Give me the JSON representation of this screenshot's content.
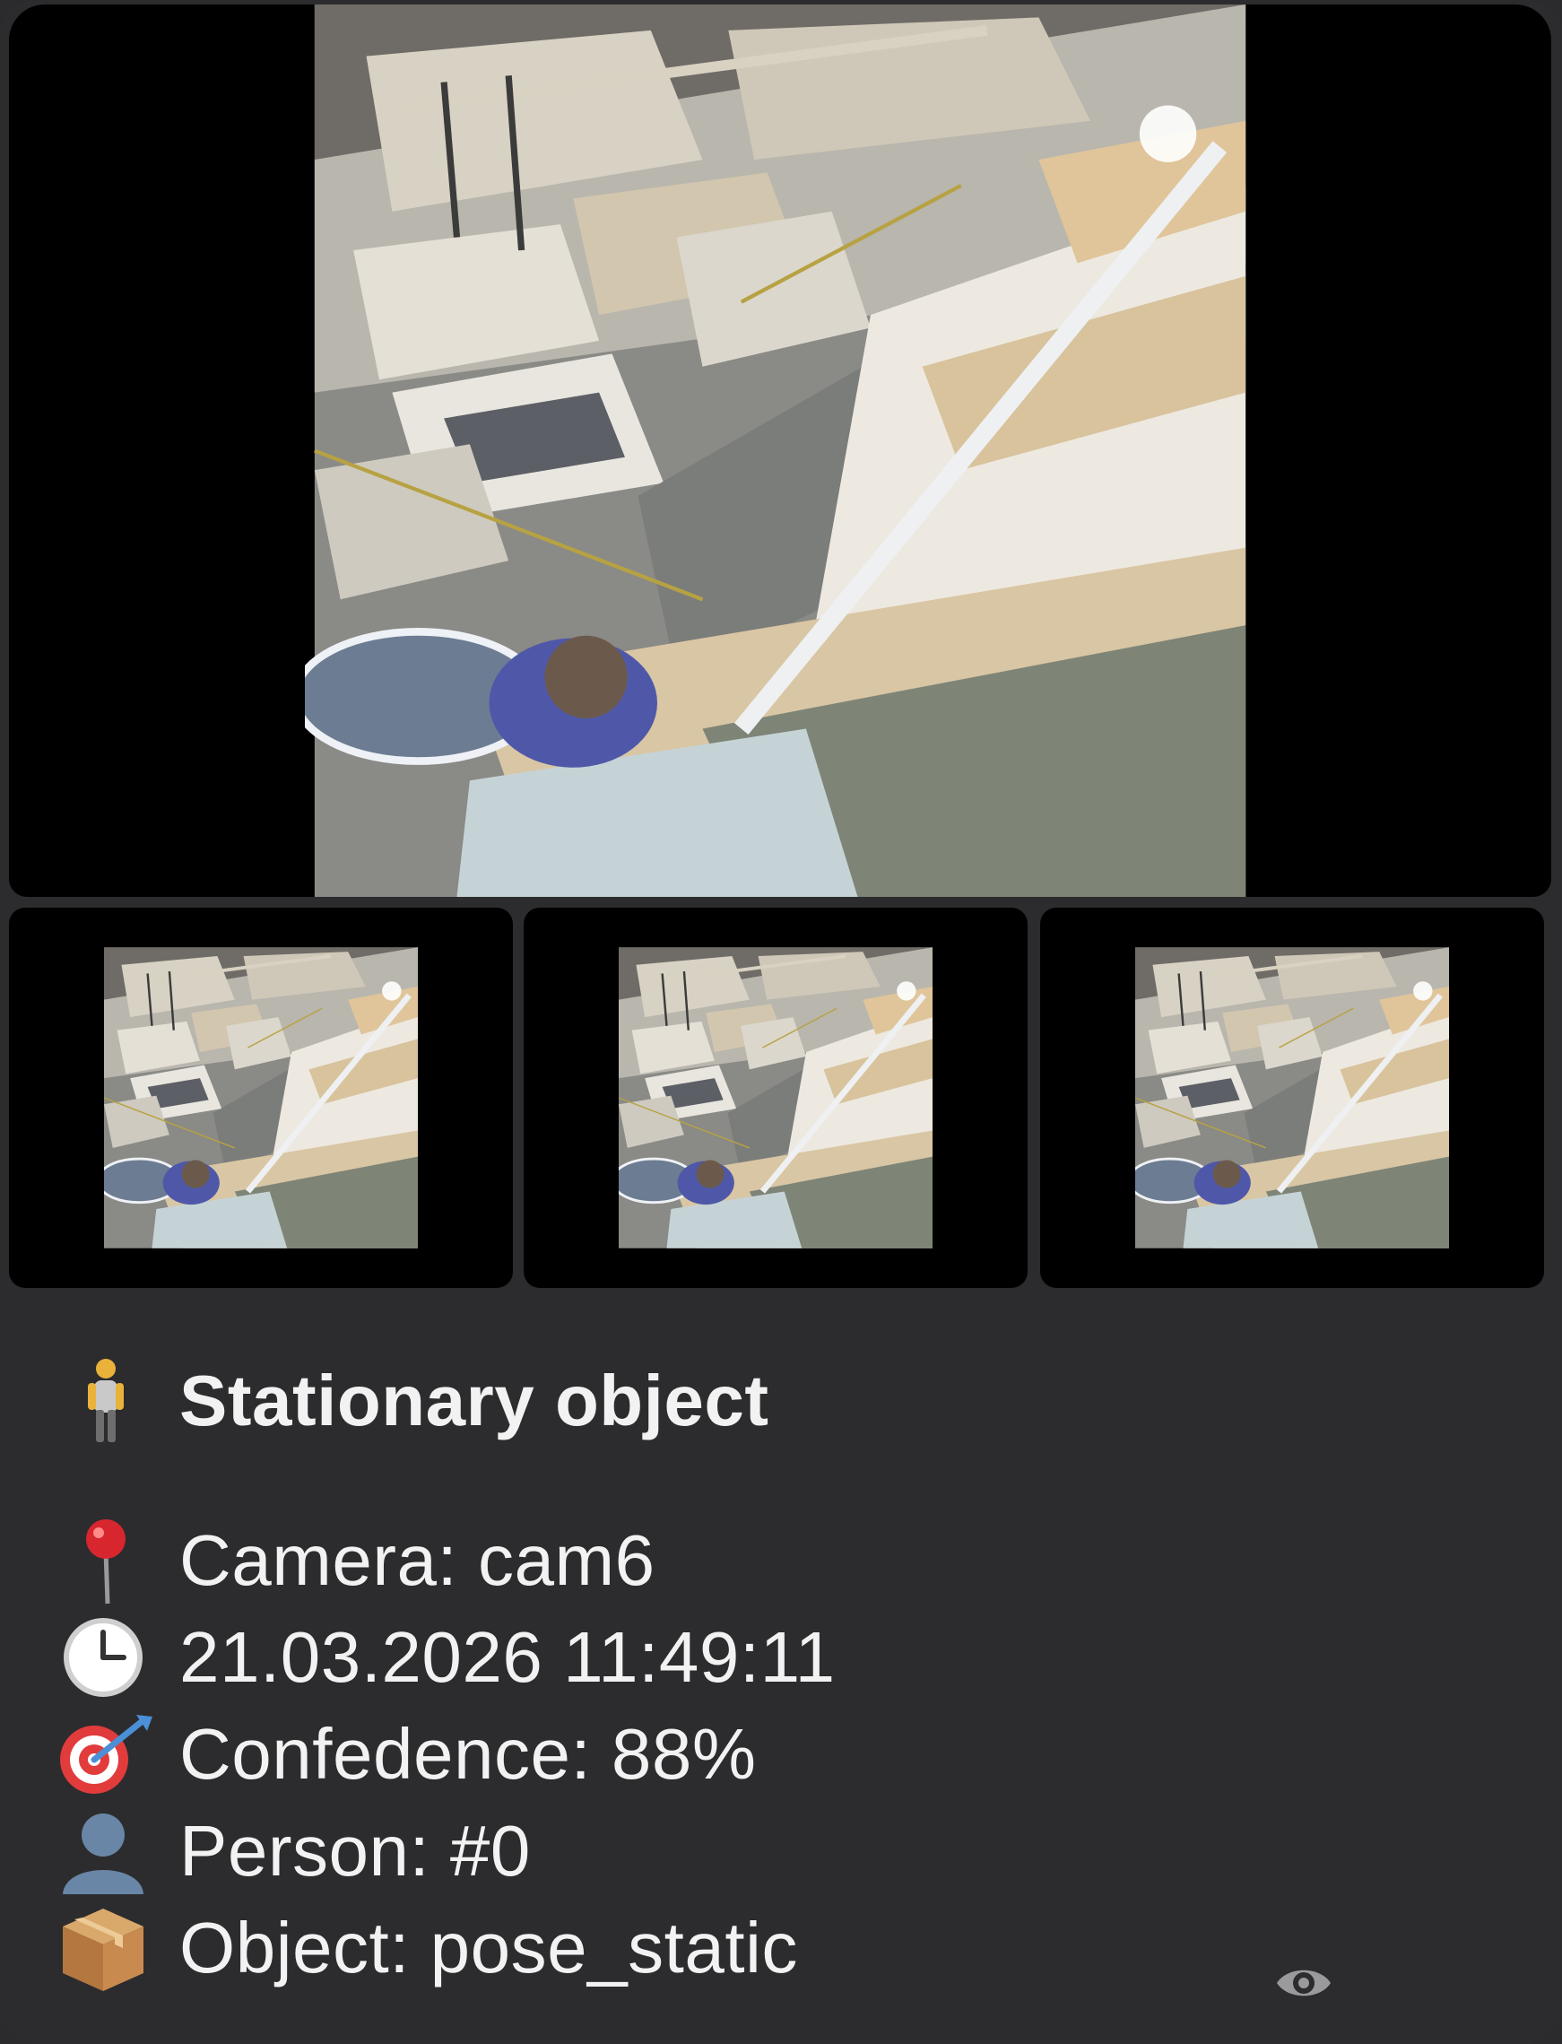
{
  "media": {
    "main_image": "warehouse-camera-frame",
    "thumbnails": [
      "warehouse-camera-frame",
      "warehouse-camera-frame",
      "warehouse-camera-frame"
    ]
  },
  "alert": {
    "title_icon": "standing-person-icon",
    "title": "Stationary object",
    "camera_icon": "round-pushpin-icon",
    "camera": "Camera: cam6",
    "time_icon": "clock-icon",
    "datetime": "21.03.2026 11:49:11",
    "confidence_icon": "direct-hit-icon",
    "confidence": "Confedence: 88%",
    "person_icon": "bust-silhouette-icon",
    "person": "Person: #0",
    "object_icon": "package-icon",
    "object": "Object: pose_static"
  },
  "footer": {
    "views_icon": "eye-icon"
  },
  "colors": {
    "background": "#2c2c2e",
    "text": "#f2f2f2"
  }
}
